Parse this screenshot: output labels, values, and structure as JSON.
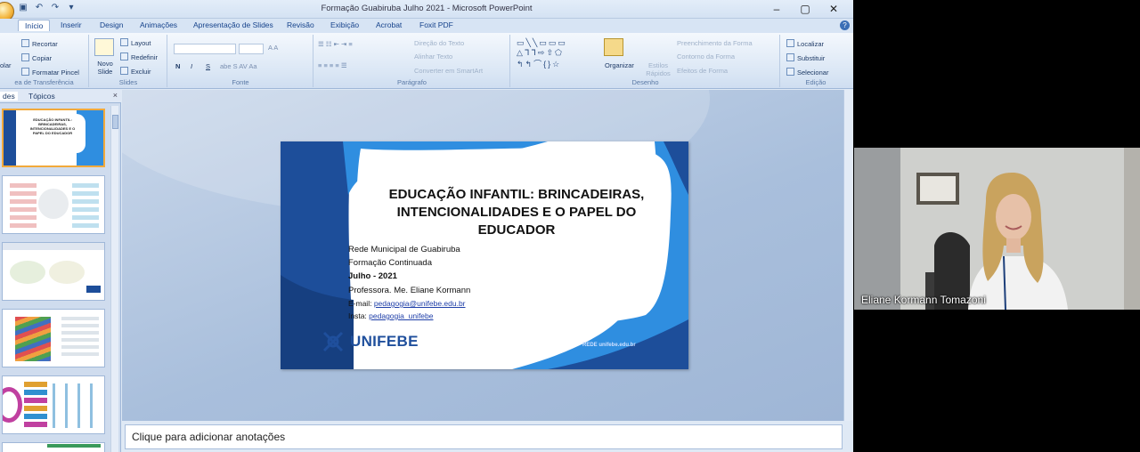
{
  "window": {
    "title": "Formação Guabiruba Julho 2021 - Microsoft PowerPoint",
    "controls": [
      "–",
      "▢",
      "✕"
    ]
  },
  "tabs": [
    "Início",
    "Inserir",
    "Design",
    "Animações",
    "Apresentação de Slides",
    "Revisão",
    "Exibição",
    "Acrobat",
    "Foxit PDF"
  ],
  "ribbon": {
    "clipboard": {
      "paste": "olar",
      "cut": "Recortar",
      "copy": "Copiar",
      "format_painter": "Formatar Pincel",
      "label": "ea de Transferência"
    },
    "slides": {
      "new_slide": "Novo Slide",
      "layout": "Layout",
      "reset": "Redefinir",
      "delete": "Excluir",
      "label": "Slides"
    },
    "font": {
      "bold": "N",
      "italic": "I",
      "underline": "S",
      "label": "Fonte"
    },
    "paragraph": {
      "text_direction": "Direção do Texto",
      "align_text": "Alinhar Texto",
      "convert_smartart": "Converter em SmartArt",
      "label": "Parágrafo"
    },
    "drawing": {
      "arrange": "Organizar",
      "quick_styles": "Estilos Rápidos",
      "shape_fill": "Preenchimento da Forma",
      "shape_outline": "Contorno da Forma",
      "shape_effects": "Efeitos de Forma",
      "label": "Desenho"
    },
    "editing": {
      "find": "Localizar",
      "replace": "Substituir",
      "select": "Selecionar",
      "label": "Edição"
    }
  },
  "left_pane": {
    "tab_slides": "des",
    "tab_outline": "Tópicos",
    "close": "×"
  },
  "slide": {
    "title": "EDUCAÇÃO INFANTIL: BRINCADEIRAS, INTENCIONALIDADES E O PAPEL DO EDUCADOR",
    "line1": "Rede Municipal de Guabiruba",
    "line2": "Formação Continuada",
    "line3": "Julho - 2021",
    "line4": "Professora. Me. Eliane Kormann",
    "email_label": "E-mail:",
    "email": "pedagogia@unifebe.edu.br",
    "insta_label": "Insta:",
    "insta": "pedagogia_unifebe",
    "logo": "UNIFEBE",
    "footer": "REDE unifebe.edu.br"
  },
  "thumb1": {
    "title": "EDUCAÇÃO INFANTIL: BRINCADEIRAS, INTENCIONALIDADES E O PAPEL DO EDUCADOR"
  },
  "notes": {
    "placeholder": "Clique para adicionar anotações"
  },
  "webcam": {
    "name": "Eliane Kormann Tomazoni"
  },
  "colors": {
    "brand_blue": "#1f4f9c",
    "slide_blue": "#1d4e9a",
    "light_blue": "#2f8ee0"
  }
}
